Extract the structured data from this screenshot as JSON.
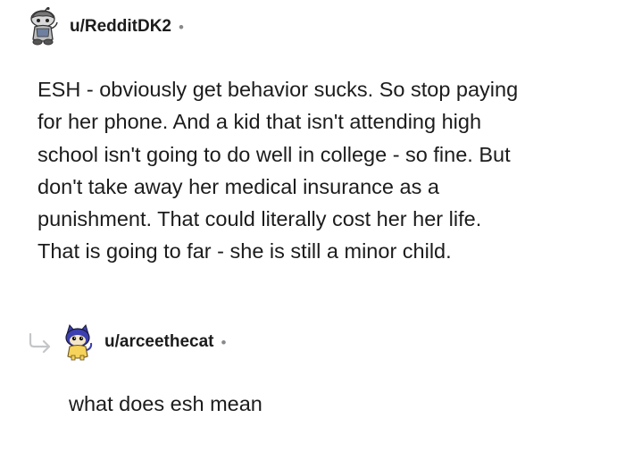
{
  "comment": {
    "username": "u/RedditDK2",
    "separator": "•",
    "avatar_icon": "reddit-snoo-avatar-icon",
    "body_lines": [
      "ESH - obviously get behavior sucks. So stop paying",
      "for her phone. And a kid that isn't attending high",
      "school isn't going to do well in college - so fine. But",
      "don't take away her medical insurance as a",
      "punishment. That could literally cost her her life.",
      "That is going to far - she is still a minor child."
    ]
  },
  "reply": {
    "username": "u/arceethecat",
    "separator": "•",
    "avatar_icon": "cat-avatar-icon",
    "reply_icon": "reply-arrow-icon",
    "body": "what does esh mean"
  },
  "colors": {
    "text": "#1c1c1c",
    "meta": "#878a8c",
    "background": "#ffffff"
  }
}
